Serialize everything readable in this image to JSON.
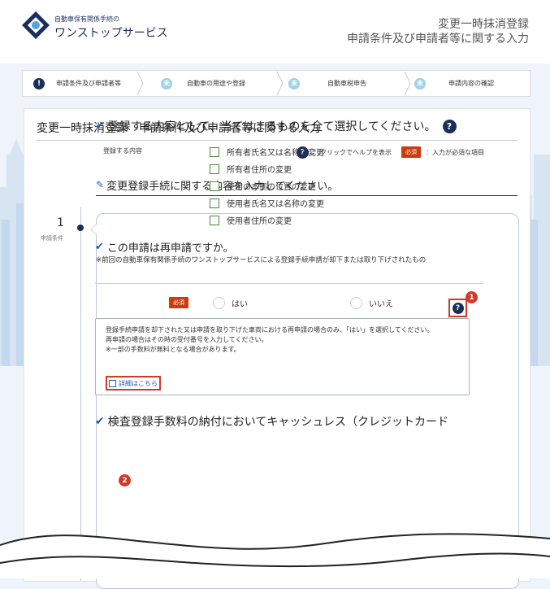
{
  "header": {
    "logo_small": "自動車保有関係手続の",
    "logo_main": "ワンストップサービス",
    "title_line1": "変更一時抹消登録",
    "title_line2": "申請条件及び申請者等に関する入力"
  },
  "steps": [
    {
      "label": "申請条件及び申請者等",
      "icon": "!"
    },
    {
      "label": "自動車の用途や登録",
      "icon": "未"
    },
    {
      "label": "自動車税申告",
      "icon": "未"
    },
    {
      "label": "申請内容の確認",
      "icon": "未"
    }
  ],
  "panel": {
    "title": "変更一時抹消登録　申請条件及び申請者等に関する入力",
    "help_icon": "?",
    "help_legend": "：クリックでヘルプを表示",
    "required_badge": "必須",
    "required_legend": "：入力が必須な項目",
    "section_title": "変更登録手続に関する内容を入力してください。"
  },
  "step_indicator": {
    "number": "1",
    "label": "申請条件"
  },
  "q1": {
    "title": "登録する内容として、当てはまるものを全て選択してください。",
    "field_label": "登録する内容",
    "options": [
      "所有者氏名又は名称の変更",
      "所有者住所の変更",
      "使用の本拠の位置の変更",
      "使用者氏名又は名称の変更",
      "使用者住所の変更"
    ]
  },
  "q2": {
    "title": "この申請は再申請ですか。",
    "note": "※前回の自動車保有関係手続のワンストップサービスによる登録手続申請が却下または取り下げされたもの",
    "required_badge": "必須",
    "yes": "はい",
    "no": "いいえ",
    "help_text_1": "登録手続申請を却下された又は申請を取り下げた車両における再申請の場合のみ、「はい」を選択してください。",
    "help_text_2": "再申請の場合はその時の受付番号を入力してください。",
    "help_text_3": "※一部の手数料が無料となる場合があります。",
    "detail_link": "詳細はこちら"
  },
  "q3": {
    "title": "検査登録手数料の納付においてキャッシュレス（クレジットカード"
  },
  "markers": [
    "1",
    "2"
  ],
  "colors": {
    "navy": "#1a2e5c",
    "required": "#cc3b10",
    "highlight": "#d13a2a",
    "link": "#1a5fb4",
    "todo": "#9fd0ea"
  }
}
